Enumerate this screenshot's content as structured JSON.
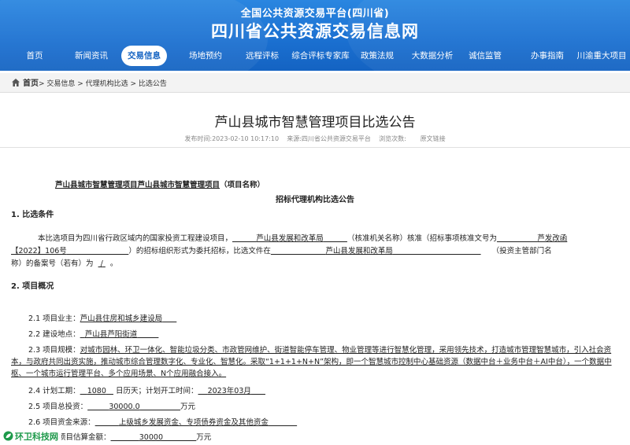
{
  "header": {
    "subtitle": "全国公共资源交易平台(四川省)",
    "title": "四川省公共资源交易信息网"
  },
  "nav": {
    "items": [
      "首页",
      "新闻资讯",
      "交易信息",
      "场地预约",
      "远程评标",
      "综合评标专家库",
      "政策法规",
      "大数据分析",
      "诚信监管",
      "办事指南",
      "川渝重大项目"
    ],
    "active": "交易信息"
  },
  "breadcrumb": {
    "home": "首页",
    "trail": "> 交易信息 > 代理机构比选 > 比选公告"
  },
  "article": {
    "title": "芦山县城市智慧管理项目比选公告",
    "meta": {
      "published_label": "发布时间:",
      "published": "2023-02-10 10:17:10",
      "source_label": "来源:",
      "source": "四川省公共资源交易平台",
      "views_label": "浏览次数:",
      "original_link": "原文链接"
    }
  },
  "doc": {
    "project_title_underlined": "芦山县城市智慧管理项目芦山县城市智慧管理项目",
    "project_name_label": "（项目名称）",
    "subtitle": "招标代理机构比选公告",
    "s1_heading": "1.   比选条件",
    "s1": {
      "t1": "本比选项目为四川省行政区域内的国家投资工程建设项目，",
      "v_approver": "芦山县发展和改革局",
      "t2": "（核准机关名称）核准（招标事项核准文号为",
      "v_doc_prefix": "芦发改函",
      "v_doc_number": "【2022】106号",
      "t3": "）的招标组织形式为委托招标，比选文件在",
      "v_filer": "芦山县发展和改革局",
      "t4": "（投资主管部门名",
      "t5": "称）的备案号（若有）为",
      "v_record": "/",
      "t6": "。"
    },
    "s2_heading": "2.   项目概况",
    "items": {
      "owner_label": "2.1 项目业主：",
      "owner": "芦山县住房和城乡建设局",
      "location_label": "2.2 建设地点：",
      "location": "芦山县芦阳街道",
      "scale_label": "2.3 项目规模：",
      "scale": "对城市园林、环卫一体化、智能垃圾分类、市政管网维护、街道智能停车管理、物业管理等进行智慧化管理，采用领先技术，打造城市管理智慧城市，引入社会资本，与政府共同出资实施，推动城市综合管理数字化、专业化、智慧化。采取“1+1+1+N+N”架构，即一个智慧城市控制中心基础资源（数据中台＋业务中台＋AI中台），一个数据中枢、一个城市运行管理平台、多个应用场景、N个应用融合接入。",
      "period_label": "2.4 计划工期：",
      "period_days": "1080",
      "period_unit": "日历天；计划开工时间：",
      "start": "2023年03月",
      "investment_label": "2.5 项目总投资：",
      "investment": "30000.0",
      "investment_unit": "万元",
      "funding_label": "2.6 项目资金来源：",
      "funding": "上级城乡发展资金、专项债券资金及其他资金",
      "estimate_label": "代理项目估算金额：",
      "estimate": "30000",
      "estimate_unit": "万元"
    }
  },
  "watermark": {
    "text": "环卫科技网"
  }
}
